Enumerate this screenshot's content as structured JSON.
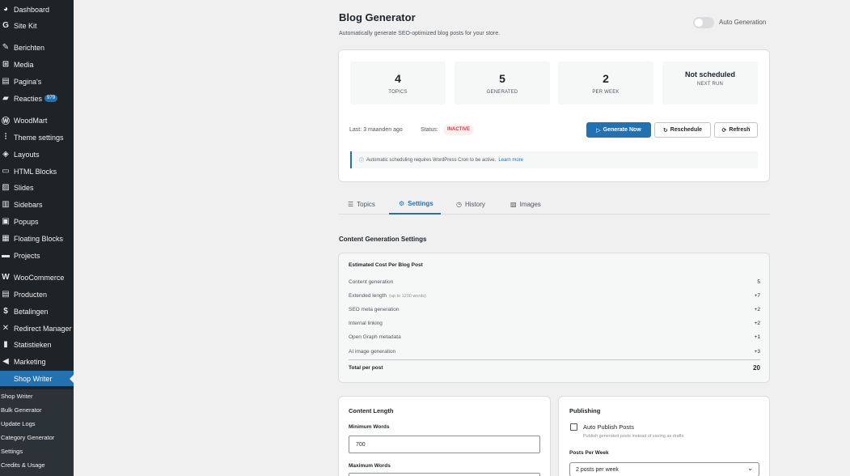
{
  "sidebar": {
    "items": [
      {
        "label": "Dashboard",
        "icon": "dashboard-icon",
        "glyph": "◕"
      },
      {
        "label": "Site Kit",
        "icon": "sitekit-icon",
        "glyph": "G"
      },
      {
        "label": "Berichten",
        "icon": "pin-icon",
        "glyph": "✎"
      },
      {
        "label": "Media",
        "icon": "media-icon",
        "glyph": "⊞"
      },
      {
        "label": "Pagina's",
        "icon": "page-icon",
        "glyph": "▤"
      },
      {
        "label": "Reacties",
        "icon": "comment-icon",
        "glyph": "▰",
        "badge": "979"
      },
      {
        "label": "WoodMart",
        "icon": "woodmart-icon",
        "glyph": "Ⓦ"
      },
      {
        "label": "Theme settings",
        "icon": "sliders-icon",
        "glyph": "⫶"
      },
      {
        "label": "Layouts",
        "icon": "layers-icon",
        "glyph": "◈"
      },
      {
        "label": "HTML Blocks",
        "icon": "html-icon",
        "glyph": "▭"
      },
      {
        "label": "Slides",
        "icon": "slides-icon",
        "glyph": "▨"
      },
      {
        "label": "Sidebars",
        "icon": "sidebar-icon",
        "glyph": "▥"
      },
      {
        "label": "Popups",
        "icon": "popup-icon",
        "glyph": "▣"
      },
      {
        "label": "Floating Blocks",
        "icon": "floating-icon",
        "glyph": "▦"
      },
      {
        "label": "Projects",
        "icon": "briefcase-icon",
        "glyph": "▬"
      },
      {
        "label": "WooCommerce",
        "icon": "woocommerce-icon",
        "glyph": "W"
      },
      {
        "label": "Producten",
        "icon": "product-icon",
        "glyph": "▤"
      },
      {
        "label": "Betalingen",
        "icon": "payment-icon",
        "glyph": "$"
      },
      {
        "label": "Redirect Manager",
        "icon": "redirect-icon",
        "glyph": "✕"
      },
      {
        "label": "Statistieken",
        "icon": "stats-icon",
        "glyph": "▮"
      },
      {
        "label": "Marketing",
        "icon": "megaphone-icon",
        "glyph": "◀"
      },
      {
        "label": "Shop Writer",
        "icon": "shopwriter-icon",
        "glyph": "",
        "active": true
      }
    ],
    "submenu": [
      "Shop Writer",
      "Bulk Generator",
      "Update Logs",
      "Category Generator",
      "Settings",
      "Credits & Usage"
    ]
  },
  "header": {
    "title": "Blog Generator",
    "description": "Automatically generate SEO-optimized blog posts for your store.",
    "toggle_label": "Auto Generation"
  },
  "stats": [
    {
      "value": "4",
      "label": "TOPICS"
    },
    {
      "value": "5",
      "label": "GENERATED"
    },
    {
      "value": "2",
      "label": "PER WEEK"
    },
    {
      "value": "Not scheduled",
      "label": "NEXT RUN"
    }
  ],
  "status": {
    "last": "Last: 3 maanden ago",
    "status_label": "Status:",
    "status_value": "INACTIVE"
  },
  "buttons": {
    "generate": "Generate Now",
    "reschedule": "Reschedule",
    "refresh": "Refresh"
  },
  "notice": {
    "text": "Automatic scheduling requires WordPress Cron to be active.",
    "link": "Learn more"
  },
  "tabs": [
    {
      "label": "Topics",
      "icon": "list-icon",
      "glyph": "☰"
    },
    {
      "label": "Settings",
      "icon": "gear-icon",
      "glyph": "⚙",
      "active": true
    },
    {
      "label": "History",
      "icon": "clock-icon",
      "glyph": "◷"
    },
    {
      "label": "Images",
      "icon": "image-icon",
      "glyph": "▨"
    }
  ],
  "section_title": "Content Generation Settings",
  "cost": {
    "title": "Estimated Cost Per Blog Post",
    "rows": [
      {
        "label": "Content generation",
        "extra": "",
        "value": "5"
      },
      {
        "label": "Extended length",
        "extra": "(up to 1200 words)",
        "value": "+7"
      },
      {
        "label": "SEO meta generation",
        "extra": "",
        "value": "+2"
      },
      {
        "label": "Internal linking",
        "extra": "",
        "value": "+2"
      },
      {
        "label": "Open Graph metadata",
        "extra": "",
        "value": "+1"
      },
      {
        "label": "AI image generation",
        "extra": "",
        "value": "+3"
      }
    ],
    "total_label": "Total per post",
    "total_value": "20"
  },
  "content_length": {
    "title": "Content Length",
    "min_label": "Minimum Words",
    "min_value": "700",
    "max_label": "Maximum Words"
  },
  "publishing": {
    "title": "Publishing",
    "auto_publish_label": "Auto Publish Posts",
    "auto_publish_help": "Publish generated posts instead of saving as drafts",
    "posts_per_week_label": "Posts Per Week",
    "posts_per_week_value": "2 posts per week"
  }
}
